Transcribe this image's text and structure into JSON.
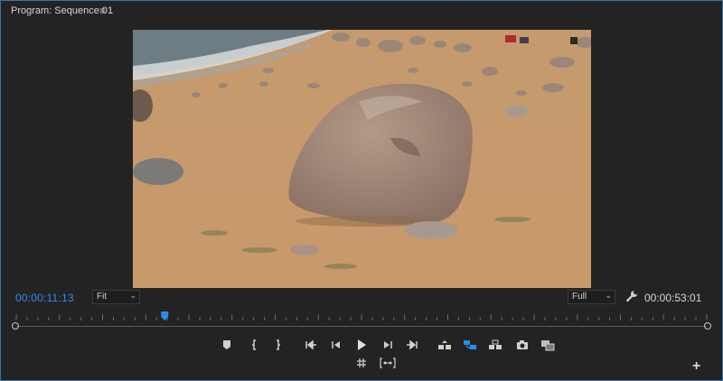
{
  "panel": {
    "title": "Program: Sequence 01",
    "menu_icon": "hamburger-menu-icon"
  },
  "monitor": {
    "current_timecode": "00:00:11:13",
    "duration_timecode": "00:00:53:01",
    "zoom_select": {
      "value": "Fit"
    },
    "resolution_select": {
      "value": "Full"
    }
  },
  "timeline": {
    "playhead_fraction": 0.215
  },
  "controls": {
    "row1": [
      "add-marker-icon",
      "mark-in-icon",
      "mark-out-icon",
      "go-to-in-icon",
      "step-back-icon",
      "play-icon",
      "step-forward-icon",
      "go-to-out-icon",
      "lift-icon",
      "extract-icon",
      "insert-icon",
      "export-frame-icon",
      "compare-view-icon"
    ],
    "row2": [
      "safe-margins-icon",
      "vr-video-icon"
    ]
  },
  "colors": {
    "accent": "#2d8ceb",
    "panel_bg": "#232323",
    "border": "#3f6fb0"
  }
}
